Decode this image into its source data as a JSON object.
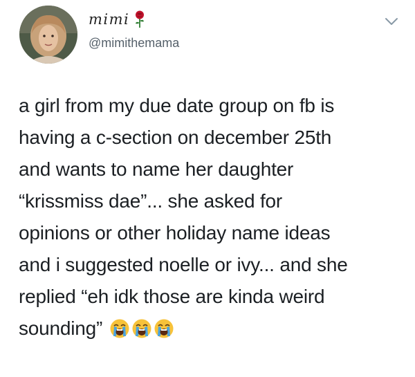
{
  "tweet": {
    "author": {
      "display_name": "mimi",
      "name_emoji": "rose-icon",
      "handle": "@mimithemama",
      "avatar": "avatar"
    },
    "menu_icon": "chevron-down-icon",
    "text_lines": [
      "a girl from my due date group on fb is",
      "having a c-section on december 25th",
      "and wants to name her daughter",
      "“krissmiss dae”... she asked for",
      "opinions or other holiday name ideas",
      "and i suggested noelle or ivy... and she",
      "replied “eh idk those are kinda weird",
      "sounding”"
    ],
    "trailing_emojis": [
      "loudly-crying-face-icon",
      "loudly-crying-face-icon",
      "loudly-crying-face-icon"
    ]
  },
  "colors": {
    "text": "#1b1f23",
    "handle": "#55606a",
    "background": "#ffffff",
    "rose": "#c0122b",
    "emoji_face": "#f7c23a",
    "emoji_tears": "#4aa3df"
  }
}
